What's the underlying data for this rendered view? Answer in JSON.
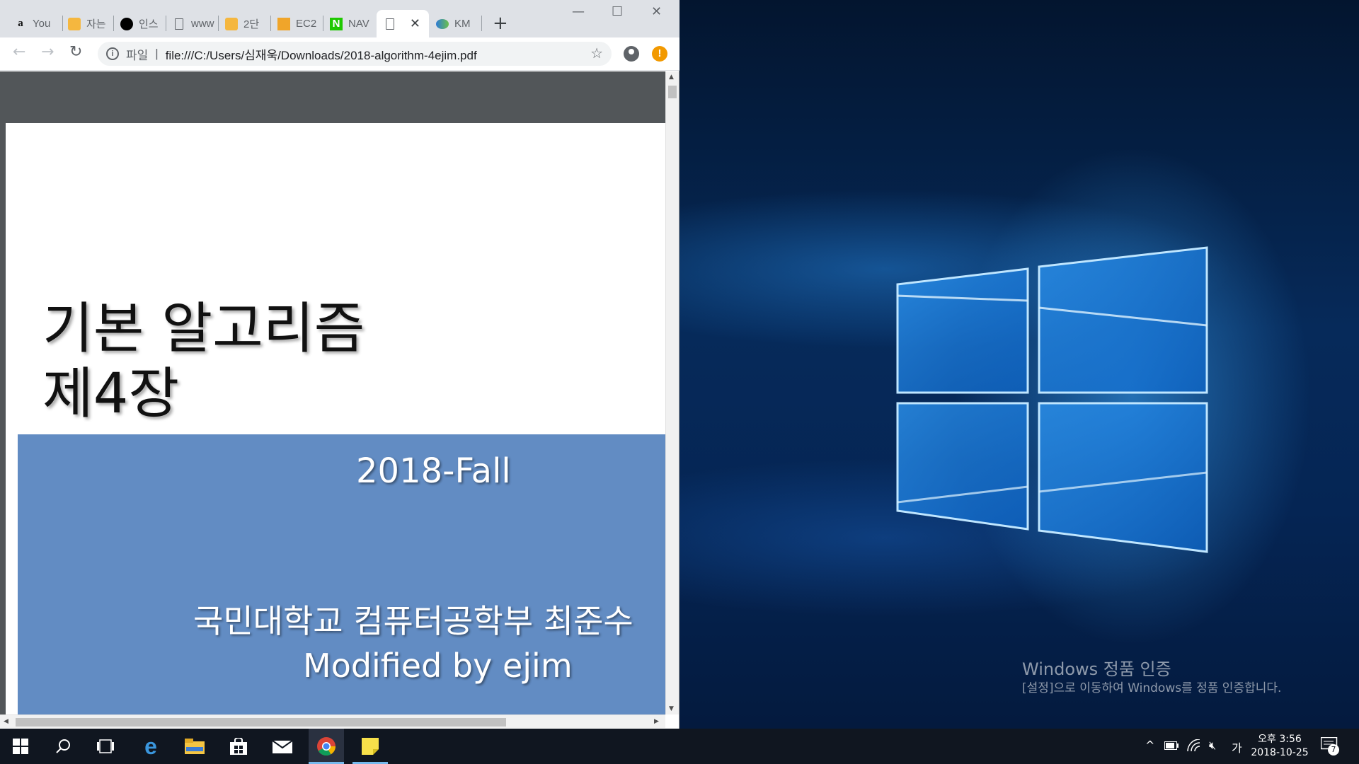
{
  "browser": {
    "tabs": [
      {
        "label": "You",
        "icon": "amazon-favicon"
      },
      {
        "label": "자는",
        "icon": "box-favicon"
      },
      {
        "label": "인스",
        "icon": "black-circle-favicon"
      },
      {
        "label": "www",
        "icon": "page-favicon"
      },
      {
        "label": "2단",
        "icon": "box-favicon"
      },
      {
        "label": "EC2",
        "icon": "aws-box-favicon"
      },
      {
        "label": "NAV",
        "icon": "naver-favicon"
      },
      {
        "label": "",
        "icon": "page-favicon",
        "active": true
      },
      {
        "label": "KM",
        "icon": "km-favicon"
      }
    ],
    "new_tab_label": "+",
    "window_controls": {
      "minimize": "—",
      "maximize": "☐",
      "close": "✕"
    },
    "toolbar": {
      "back": "←",
      "forward": "→",
      "reload": "↻",
      "scheme_label": "파일",
      "url": "file:///C:/Users/심재욱/Downloads/2018-algorithm-4ejim.pdf",
      "bookmark_icon": "star-icon"
    }
  },
  "pdf": {
    "title_line1": "기본 알고리즘",
    "title_line2": "제4장",
    "semester": "2018-Fall",
    "author": "국민대학교 컴퓨터공학부 최준수",
    "modified": "Modified by ejim",
    "band_color": "#628cc3"
  },
  "desktop": {
    "activation_title": "Windows 정품 인증",
    "activation_sub": "[설정]으로 이동하여 Windows를 정품 인증합니다."
  },
  "taskbar": {
    "time": "오후 3:56",
    "date": "2018-10-25",
    "ime": "가",
    "notification_count": "7"
  }
}
